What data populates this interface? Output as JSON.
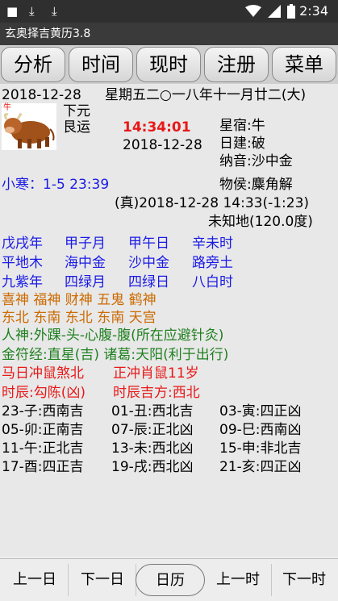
{
  "status_bar": {
    "time": "2:34",
    "icons": [
      "notification-square-icon",
      "download-icon",
      "download-icon",
      "wifi-icon",
      "signal-icon",
      "battery-icon"
    ]
  },
  "app_title": "玄奥择吉黄历3.8",
  "tabs": [
    "分析",
    "时间",
    "现时",
    "注册",
    "菜单"
  ],
  "header": {
    "date": "2018-12-28",
    "weekday_lunar": "星期五二○一八年十一月廿二(大)",
    "yuan_line1": "下元",
    "yuan_line2": "艮运",
    "zodiac_tag": "牛",
    "clock": "14:34:01",
    "date2": "2018-12-28",
    "xingxiu": "星宿:牛",
    "rijian": "日建:破",
    "nayin": "纳音:沙中金",
    "solar_term": "小寒：1-5 23:39",
    "wuhou": "物侯:麋角解",
    "true_time": "(真)2018-12-28 14:33(-1:23)",
    "location": "未知地(120.0度)"
  },
  "ganzhi": {
    "row1": [
      "戊戌年",
      "甲子月",
      "甲午日",
      "辛未时"
    ],
    "row2": [
      "平地木",
      "海中金",
      "沙中金",
      "路旁土"
    ],
    "row3": [
      "九紫年",
      "四绿月",
      "四绿日",
      "八白时"
    ]
  },
  "gods": {
    "names": "喜神 福神 财神 五鬼 鹤神",
    "directions": "东北 东南 东北 东南 天宫"
  },
  "info": {
    "renshen": "人神:外踝-头-心腹-腹(所在应避针灸)",
    "jinfujing": "金符经:直星(吉) 诸葛:天阳(利于出行)",
    "chong_day": "马日冲鼠煞北",
    "chong_zodiac": "正冲肖鼠11岁",
    "shichen": "时辰:勾陈(凶)",
    "shichen_direction": "时辰吉方:西北"
  },
  "hours": [
    [
      "23-子:西南吉",
      "01-丑:西北吉",
      "03-寅:四正凶"
    ],
    [
      "05-卯:正南吉",
      "07-辰:正北凶",
      "09-巳:西南凶"
    ],
    [
      "11-午:正北吉",
      "13-未:西北凶",
      "15-申:非北吉"
    ],
    [
      "17-酉:四正吉",
      "19-戌:西北凶",
      "21-亥:四正凶"
    ]
  ],
  "bottom_buttons": [
    "上一日",
    "下一日",
    "日历",
    "上一时",
    "下一时"
  ],
  "colors": {
    "blue": "#1a1ae6",
    "orange": "#cc6a00",
    "green": "#208020",
    "red": "#e81818",
    "clock_red": "#e81818"
  }
}
